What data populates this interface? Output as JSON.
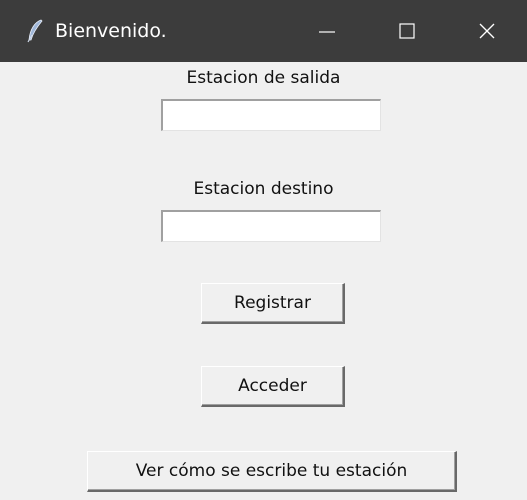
{
  "window": {
    "title": "Bienvenido.",
    "icon": "feather-icon",
    "controls": [
      "minimize-icon",
      "maximize-icon",
      "close-icon"
    ]
  },
  "form": {
    "origin_label": "Estacion de salida",
    "origin_value": "",
    "destination_label": "Estacion destino",
    "destination_value": ""
  },
  "buttons": {
    "register_label": "Registrar",
    "login_label": "Acceder",
    "howto_label": "Ver cómo se escribe tu estación"
  }
}
